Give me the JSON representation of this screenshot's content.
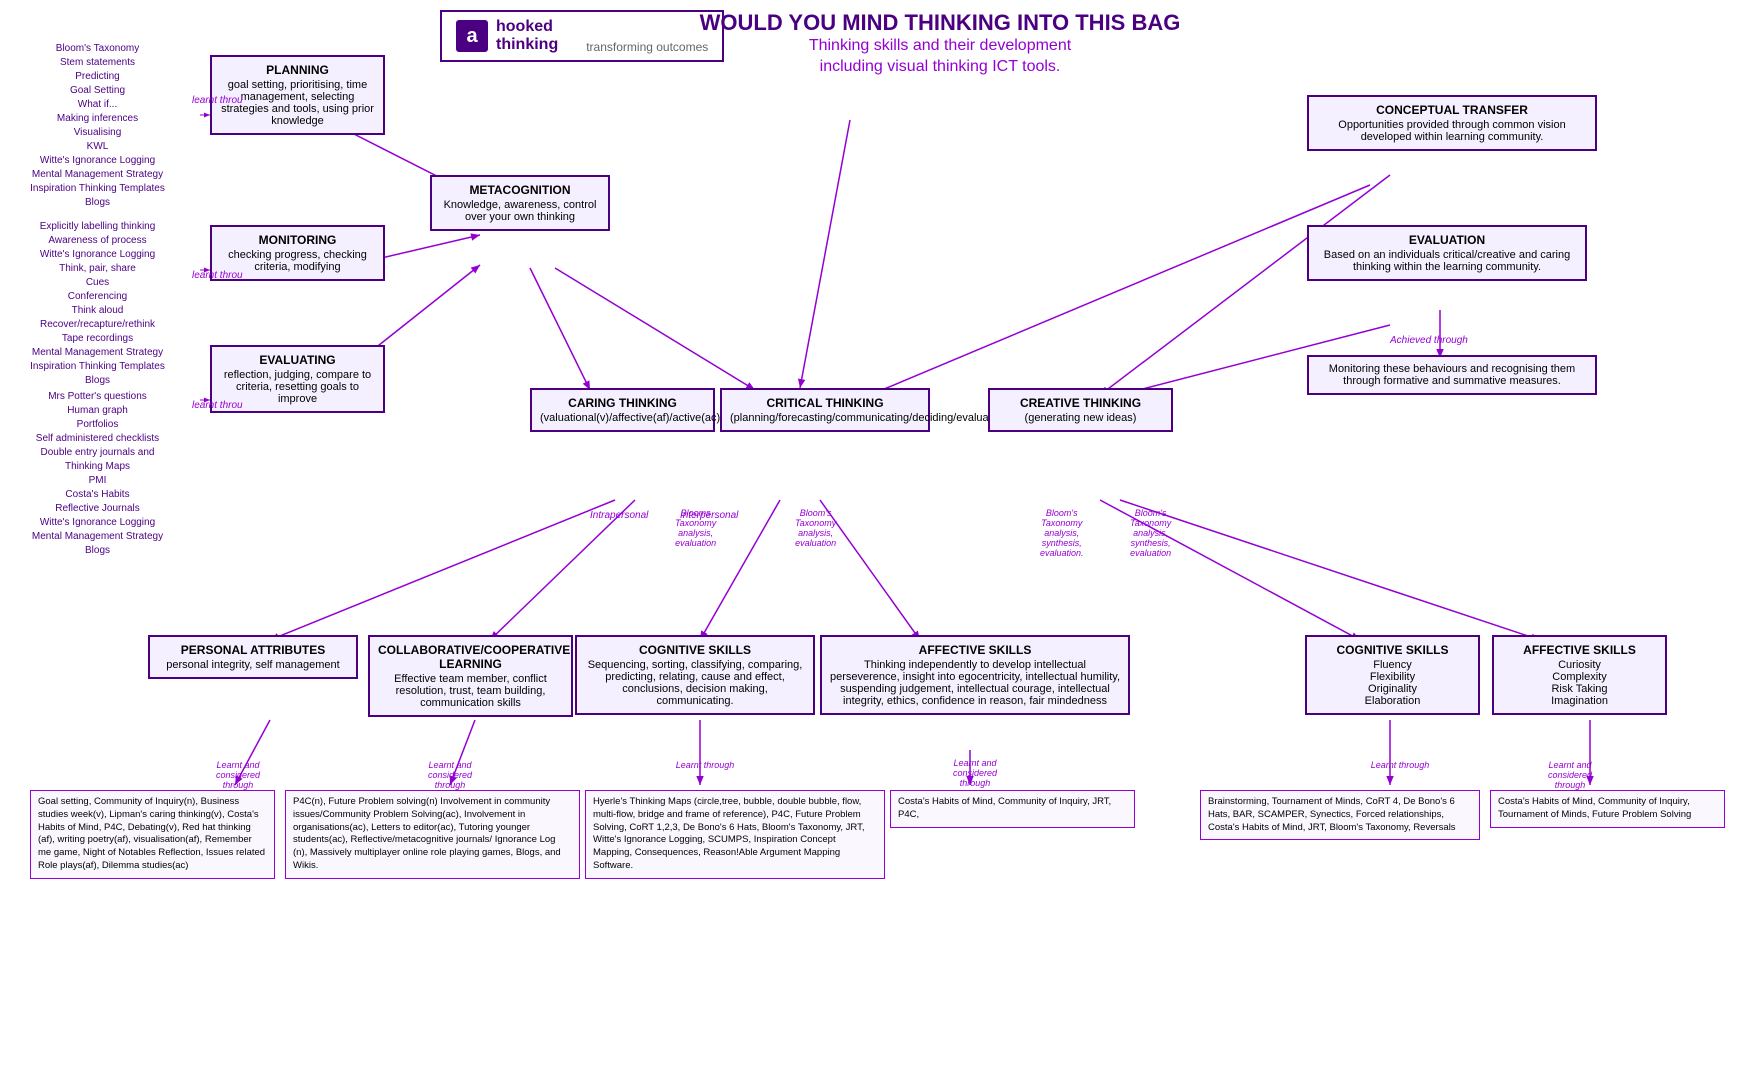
{
  "logo": {
    "icon": "a",
    "line1": "hooked",
    "line2": "thinking",
    "tagline": "transforming outcomes"
  },
  "header": {
    "title": "WOULD YOU MIND THINKING INTO THIS BAG",
    "subtitle": "Thinking skills and their development\nincluding visual thinking ICT tools."
  },
  "nodes": {
    "planning": {
      "title": "PLANNING",
      "body": "goal setting, prioritising, time management, selecting strategies and tools, using prior knowledge"
    },
    "metacognition": {
      "title": "METACOGNITION",
      "body": "Knowledge, awareness, control over your own thinking"
    },
    "monitoring": {
      "title": "MONITORING",
      "body": "checking progress, checking criteria, modifying"
    },
    "evaluating": {
      "title": "EVALUATING",
      "body": "reflection, judging, compare to criteria, resetting goals to improve"
    },
    "conceptual_transfer": {
      "title": "CONCEPTUAL  TRANSFER",
      "body": "Opportunities provided through common vision developed within learning community."
    },
    "evaluation": {
      "title": "EVALUATION",
      "body": "Based on an individuals critical/creative and caring thinking within the learning community."
    },
    "monitoring_behaviours": {
      "body": "Monitoring these behaviours and recognising them through formative and summative measures."
    },
    "caring_thinking": {
      "title": "CARING THINKING",
      "body": "(valuational(v)/affective(af)/active(ac)/normative(n))"
    },
    "critical_thinking": {
      "title": "CRITICAL THINKING",
      "body": "(planning/forecasting/communicating/deciding/evaluating)"
    },
    "creative_thinking": {
      "title": "CREATIVE THINKING",
      "body": "(generating new ideas)"
    },
    "personal_attributes": {
      "title": "PERSONAL ATTRIBUTES",
      "body": "personal integrity, self management"
    },
    "collaborative_learning": {
      "title": "COLLABORATIVE/COOPERATIVE LEARNING",
      "body": "Effective team member, conflict resolution, trust, team building, communication skills"
    },
    "cognitive_skills_center": {
      "title": "COGNITIVE SKILLS",
      "body": "Sequencing, sorting, classifying, comparing, predicting, relating, cause and effect, conclusions, decision making, communicating."
    },
    "affective_skills_center": {
      "title": "AFFECTIVE SKILLS",
      "body": "Thinking independently to develop intellectual perseverence, insight into egocentricity, intellectual humility, suspending judgement, intellectual courage, intellectual integrity, ethics, confidence in reason, fair mindedness"
    },
    "cognitive_skills_right": {
      "title": "COGNITIVE SKILLS",
      "body": "Fluency\nFlexibility\nOriginality\nElaboration"
    },
    "affective_skills_right": {
      "title": "AFFECTIVE SKILLS",
      "body": "Curiosity\nComplexity\nRisk Taking\nImagination"
    }
  },
  "side_lists": {
    "left_top": "Bloom's Taxonomy\nStem statements\nPredicting\nGoal Setting\nWhat if...\nMaking inferences\nVisualising\nKWL\nWitte's Ignorance Logging\nMental Management Strategy\nInspiration Thinking Templates\nBlogs",
    "left_mid": "Explicitly labelling thinking\nAwareness of process\nWitte's Ignorance Logging\nThink, pair, share\nCues\nConferencing\nThink aloud\nRecover/recapture/rethink\nTape recordings\nMental Management Strategy\nInspiration Thinking Templates\nBlogs",
    "left_bot": "Mrs Potter's questions\nHuman graph\nPortfolios\nSelf administered checklists\nDouble entry journals and\nThinking Maps\nPMI\nCosta's Habits\nReflective Journals\nWitte's Ignorance Logging\nMental Management Strategy\nBlogs"
  },
  "arrow_labels": {
    "learnt_through_top_left": "learnt throu",
    "learnt_through_mid_left": "learnt throu",
    "learnt_through_bot_left": "learnt throu",
    "achieved_through": "Achieved through",
    "intrapersonal": "Intrapersonal",
    "interpersonal": "Interpersonal",
    "blooms_analysis_eval1": "Blooms\nTaxonomy\nanalysis,\nevaluation",
    "blooms_analysis_eval2": "Bloom's\nTaxonomy\nanalysis,\nevaluation",
    "blooms_analysis_syn1": "Bloom's\nTaxonomy\nanalysis,\nsynthesis,\nevaluation.",
    "blooms_analysis_syn2": "Bloom's\nTaxonomy\nanalysis,\nsynthesis,\nevaluation"
  },
  "bottom_boxes": {
    "personal_learnt": "Goal setting, Community of Inquiry(n), Business studies week(v), Lipman's caring thinking(v), Costa's Habits of Mind, P4C, Debating(v), Red hat thinking (af), writing poetry(af), visualisation(af), Remember me game, Night of Notables Reflection, Issues related Role plays(af), Dilemma studies(ac)",
    "collaborative_learnt": "P4C(n), Future Problem solving(n) Involvement in community issues/Community Problem Solving(ac), Involvement in organisations(ac), Letters to editor(ac), Tutoring younger students(ac), Reflective/metacognitive journals/ Ignorance Log (n), Massively multiplayer online role playing games, Blogs, and Wikis.",
    "cognitive_center_learnt": "Hyerle's Thinking Maps (circle,tree, bubble, double bubble, flow, multi-flow, bridge and frame of reference), P4C, Future Problem Solving, CoRT 1,2,3, De Bono's 6 Hats, Bloom's Taxonomy, JRT, Witte's Ignorance Logging, SCUMPS, Inspiration Concept Mapping, Consequences, Reason!Able Argument Mapping Software.",
    "affective_center_learnt": "Costa's Habits of Mind, Community of Inquiry, JRT, P4C,",
    "cognitive_right_learnt": "Brainstorming, Tournament of Minds, CoRT 4, De Bono's 6 Hats, BAR, SCAMPER, Synectics, Forced relationships, Costa's Habits of Mind, JRT, Bloom's Taxonomy, Reversals",
    "affective_right_learnt": "Costa's Habits of Mind, Community of Inquiry, Tournament of Minds, Future Problem Solving"
  },
  "learnt_labels": {
    "personal": "Learnt and\nconsidered\nthrough",
    "collaborative": "Learnt and\nconsidered\nthrough",
    "cognitive_center": "Learnt through",
    "affective_center": "Learnt and\nconsidered\nthrough",
    "cognitive_right": "Learnt through",
    "affective_right": "Learnt and\nconsidered\nthrough"
  }
}
